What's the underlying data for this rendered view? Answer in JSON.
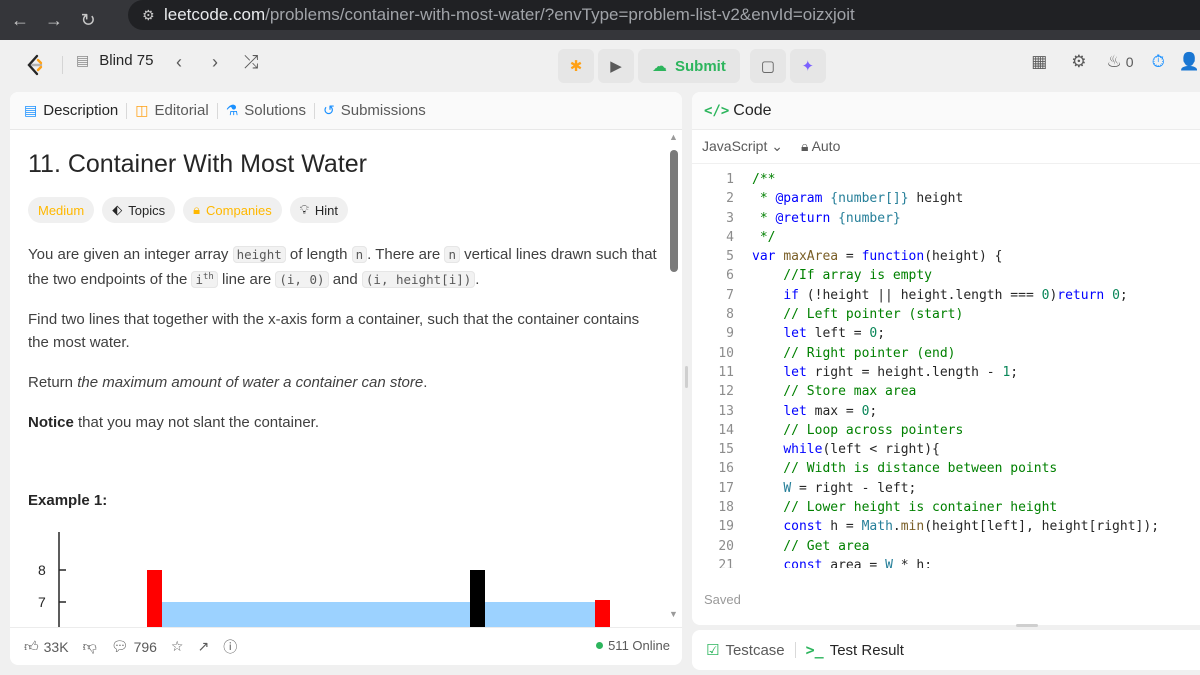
{
  "browser": {
    "url_host": "leetcode.com",
    "url_path": "/problems/container-with-most-water/?envType=problem-list-v2&envId=oizxjoit"
  },
  "header": {
    "list_name": "Blind 75",
    "submit_label": "Submit",
    "streak_count": "0"
  },
  "left_tabs": [
    {
      "label": "Description"
    },
    {
      "label": "Editorial"
    },
    {
      "label": "Solutions"
    },
    {
      "label": "Submissions"
    }
  ],
  "problem": {
    "title": "11. Container With Most Water",
    "tags": {
      "difficulty": "Medium",
      "topics": "Topics",
      "companies": "Companies",
      "hint": "Hint"
    },
    "p1": {
      "a": "You are given an integer array ",
      "code1": "height",
      "b": " of length ",
      "code2": "n",
      "c": ". There are ",
      "code3": "n",
      "d": " vertical lines drawn such that the two endpoints of the ",
      "i": "i",
      "sup": "th",
      "e": " line are ",
      "code4": "(i, 0)",
      "f": " and ",
      "code5": "(i, height[i])",
      "g": "."
    },
    "p2": "Find two lines that together with the x-axis form a container, such that the container contains the most water.",
    "p3": {
      "a": "Return ",
      "em": "the maximum amount of water a container can store",
      "b": "."
    },
    "p4": {
      "bold": "Notice",
      "rest": " that you may not slant the container."
    },
    "example_heading": "Example 1:",
    "chart_ticks": [
      "8",
      "7"
    ]
  },
  "footer": {
    "likes": "33K",
    "comments": "796",
    "online": "511 Online"
  },
  "code_panel": {
    "tab_label": "Code",
    "language": "JavaScript",
    "mode": "Auto",
    "saved_label": "Saved",
    "lines": [
      [
        {
          "c": "cm",
          "t": "/**"
        }
      ],
      [
        {
          "c": "cm",
          "t": " * "
        },
        {
          "c": "k",
          "t": "@param"
        },
        {
          "c": "t",
          "t": " {number[]}"
        },
        {
          "c": "",
          "t": " height"
        }
      ],
      [
        {
          "c": "cm",
          "t": " * "
        },
        {
          "c": "k",
          "t": "@return"
        },
        {
          "c": "t",
          "t": " {number}"
        }
      ],
      [
        {
          "c": "cm",
          "t": " */"
        }
      ],
      [
        {
          "c": "k",
          "t": "var"
        },
        {
          "c": "",
          "t": " "
        },
        {
          "c": "fn",
          "t": "maxArea"
        },
        {
          "c": "",
          "t": " = "
        },
        {
          "c": "k",
          "t": "function"
        },
        {
          "c": "",
          "t": "(height) {"
        }
      ],
      [
        {
          "c": "cm",
          "t": "    //If array is empty"
        }
      ],
      [
        {
          "c": "",
          "t": "    "
        },
        {
          "c": "k",
          "t": "if"
        },
        {
          "c": "",
          "t": " (!height || height.length === "
        },
        {
          "c": "n",
          "t": "0"
        },
        {
          "c": "",
          "t": ")"
        },
        {
          "c": "k",
          "t": "return"
        },
        {
          "c": "",
          "t": " "
        },
        {
          "c": "n",
          "t": "0"
        },
        {
          "c": "",
          "t": ";"
        }
      ],
      [
        {
          "c": "cm",
          "t": "    // Left pointer (start)"
        }
      ],
      [
        {
          "c": "",
          "t": "    "
        },
        {
          "c": "k",
          "t": "let"
        },
        {
          "c": "",
          "t": " left = "
        },
        {
          "c": "n",
          "t": "0"
        },
        {
          "c": "",
          "t": ";"
        }
      ],
      [
        {
          "c": "cm",
          "t": "    // Right pointer (end)"
        }
      ],
      [
        {
          "c": "",
          "t": "    "
        },
        {
          "c": "k",
          "t": "let"
        },
        {
          "c": "",
          "t": " right = height.length - "
        },
        {
          "c": "n",
          "t": "1"
        },
        {
          "c": "",
          "t": ";"
        }
      ],
      [
        {
          "c": "cm",
          "t": "    // Store max area"
        }
      ],
      [
        {
          "c": "",
          "t": "    "
        },
        {
          "c": "k",
          "t": "let"
        },
        {
          "c": "",
          "t": " max = "
        },
        {
          "c": "n",
          "t": "0"
        },
        {
          "c": "",
          "t": ";"
        }
      ],
      [
        {
          "c": "cm",
          "t": "    // Loop across pointers"
        }
      ],
      [
        {
          "c": "",
          "t": "    "
        },
        {
          "c": "k",
          "t": "while"
        },
        {
          "c": "",
          "t": "(left < right){"
        }
      ],
      [
        {
          "c": "cm",
          "t": "    // Width is distance between points"
        }
      ],
      [
        {
          "c": "",
          "t": "    "
        },
        {
          "c": "t",
          "t": "W"
        },
        {
          "c": "",
          "t": " = right - left;"
        }
      ],
      [
        {
          "c": "cm",
          "t": "    // Lower height is container height"
        }
      ],
      [
        {
          "c": "",
          "t": "    "
        },
        {
          "c": "k",
          "t": "const"
        },
        {
          "c": "",
          "t": " h = "
        },
        {
          "c": "t",
          "t": "Math"
        },
        {
          "c": "",
          "t": "."
        },
        {
          "c": "fn",
          "t": "min"
        },
        {
          "c": "",
          "t": "(height[left], height[right]);"
        }
      ],
      [
        {
          "c": "cm",
          "t": "    // Get area"
        }
      ],
      [
        {
          "c": "",
          "t": "    "
        },
        {
          "c": "k",
          "t": "const"
        },
        {
          "c": "",
          "t": " area = "
        },
        {
          "c": "t",
          "t": "W"
        },
        {
          "c": "",
          "t": " * h;"
        }
      ]
    ]
  },
  "bottom_tabs": [
    {
      "label": "Testcase"
    },
    {
      "label": "Test Result"
    }
  ],
  "colors": {
    "accent_green": "#2db55d",
    "medium": "#ffb800",
    "bar_red": "#ff0000",
    "water_blue": "#9cd2ff"
  }
}
